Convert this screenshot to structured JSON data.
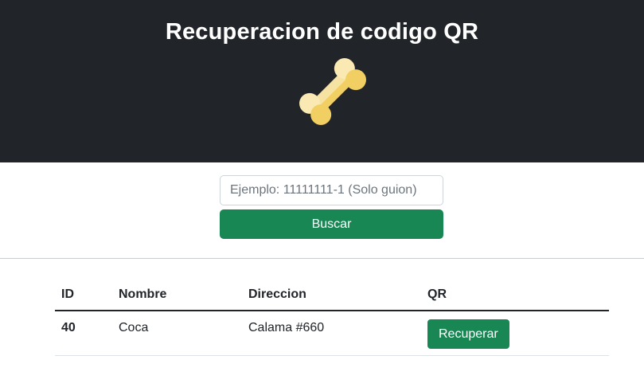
{
  "header": {
    "title": "Recuperacion de codigo QR",
    "logo_icon": "bone-icon",
    "background": "#212529"
  },
  "search": {
    "placeholder": "Ejemplo: 11111111-1 (Solo guion)",
    "value": "",
    "button_label": "Buscar",
    "button_color": "#198754"
  },
  "table": {
    "columns": [
      "ID",
      "Nombre",
      "Direccion",
      "QR"
    ],
    "rows": [
      {
        "id": "40",
        "nombre": "Coca",
        "direccion": "Calama #660",
        "qr_button_label": "Recuperar"
      }
    ]
  }
}
